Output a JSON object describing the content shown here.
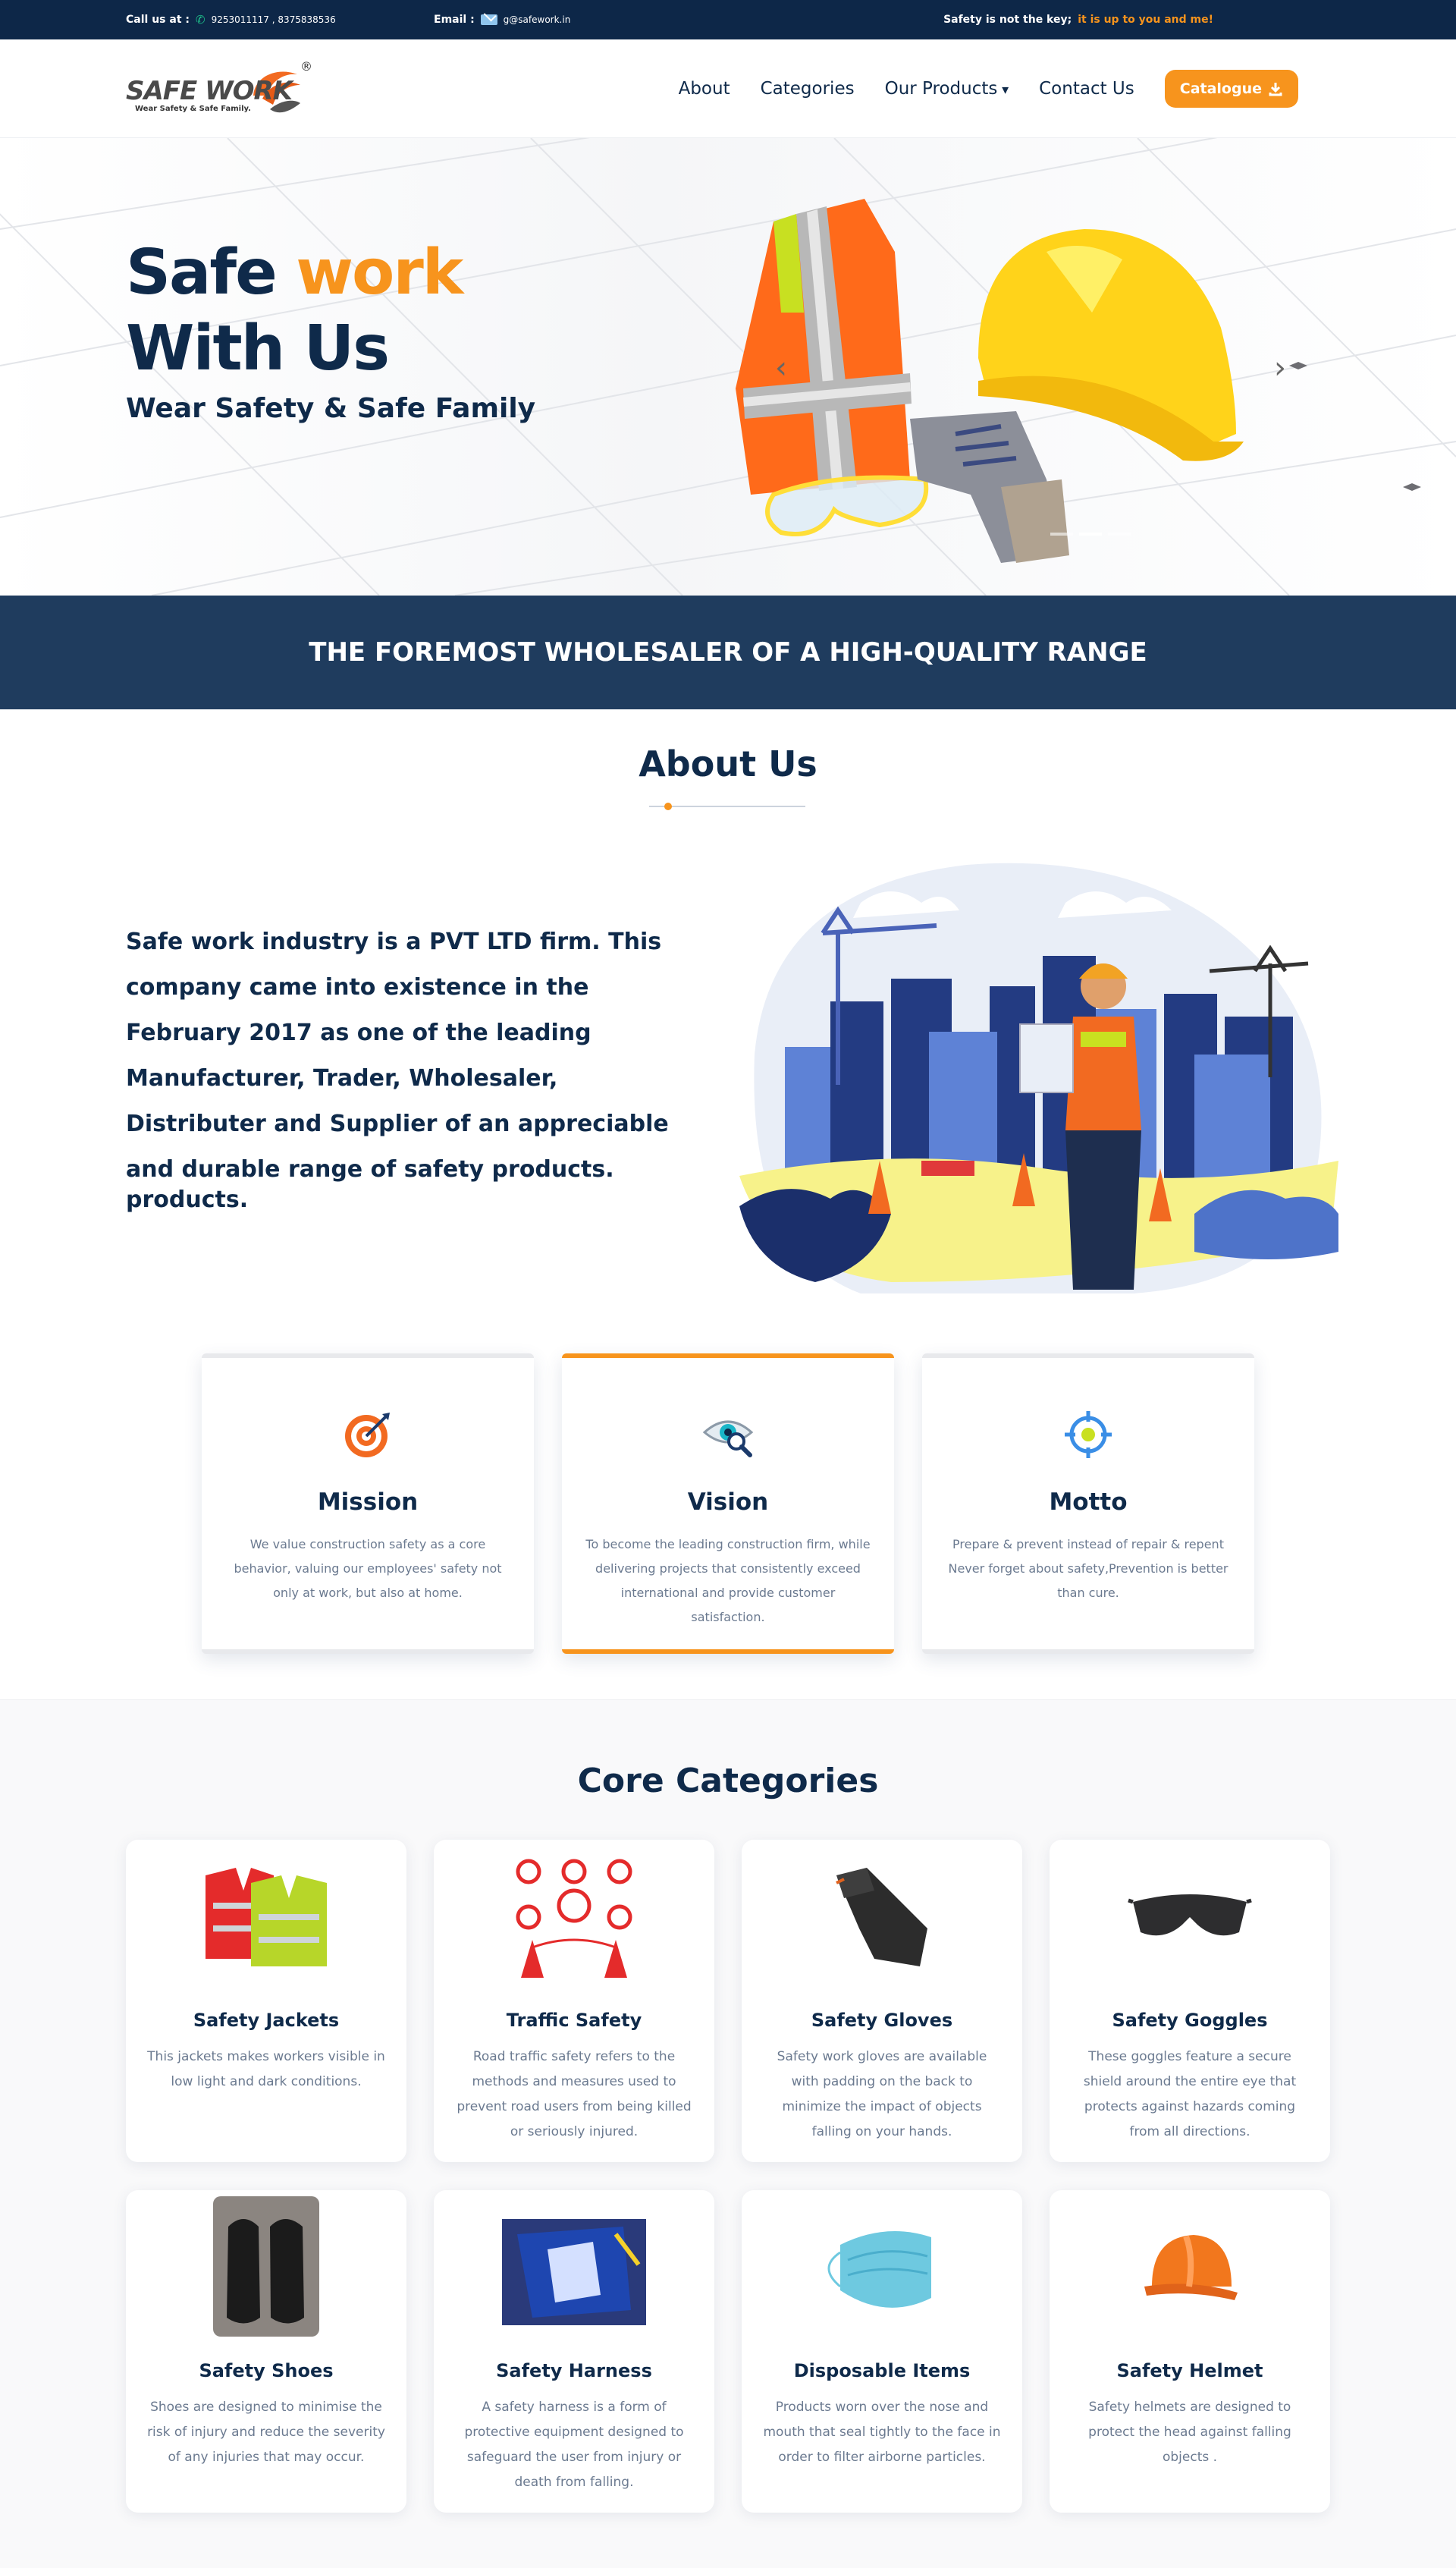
{
  "topbar": {
    "call_label": "Call us at :",
    "phones": "9253011117 , 8375838536",
    "email_label": "Email :",
    "email": "g@safework.in",
    "slogan_a": "Safety is not the key;",
    "slogan_b": "it is up to you and me!"
  },
  "header": {
    "logo_text": "SAFE WORK",
    "logo_tagline": "Wear Safety & Safe Family.",
    "logo_reg": "®",
    "nav": [
      {
        "label": "About"
      },
      {
        "label": "Categories"
      },
      {
        "label": "Our Products"
      },
      {
        "label": "Contact Us"
      }
    ],
    "catalogue_label": "Catalogue"
  },
  "hero": {
    "title_a": "Safe",
    "title_b": "work",
    "title_c": "With Us",
    "subtitle": "Wear Safety & Safe Family",
    "arrow_prev": "‹",
    "arrow_next": "›",
    "slides": 3,
    "active_slide": 2
  },
  "banner": {
    "text": "THE FOREMOST WHOLESALER OF A HIGH-QUALITY RANGE"
  },
  "about": {
    "title": "About Us",
    "text": "Safe work industry is a PVT LTD firm. This company came into existence in the February 2017 as one of the leading Manufacturer, Trader, Wholesaler, Distributer and Supplier of an appreciable and durable range of safety products.",
    "ghost_text": "products."
  },
  "mvm": [
    {
      "icon": "target-icon",
      "title": "Mission",
      "text": "We value construction safety as a core behavior, valuing our employees' safety not only at work, but also at home."
    },
    {
      "icon": "vision-icon",
      "title": "Vision",
      "text": "To become the leading construction firm, while delivering projects that consistently exceed international and provide customer satisfaction."
    },
    {
      "icon": "crosshair-icon",
      "title": "Motto",
      "text": "Prepare & prevent instead of repair & repent Never forget about safety,Prevention is better than cure."
    }
  ],
  "core": {
    "title": "Core Categories",
    "items": [
      {
        "name": "Safety Jackets",
        "desc": "This jackets makes workers visible in low light and dark conditions."
      },
      {
        "name": "Traffic Safety",
        "desc": "Road traffic safety refers to the methods and measures used to prevent road users from being killed or seriously injured."
      },
      {
        "name": "Safety Gloves",
        "desc": "Safety work gloves are available with padding on the back to minimize the impact of objects falling on your hands."
      },
      {
        "name": "Safety Goggles",
        "desc": "These goggles feature a secure shield around the entire eye that protects against hazards coming from all directions."
      },
      {
        "name": "Safety Shoes",
        "desc": "Shoes are designed to minimise the risk of injury and reduce the severity of any injuries that may occur."
      },
      {
        "name": "Safety Harness",
        "desc": "A safety harness is a form of protective equipment designed to safeguard the user from injury or death from falling."
      },
      {
        "name": "Disposable Items",
        "desc": "Products worn over the nose and mouth that seal tightly to the face in order to filter airborne particles."
      },
      {
        "name": "Safety Helmet",
        "desc": "Safety helmets are designed to protect the head against falling objects ."
      }
    ]
  },
  "colors": {
    "navy": "#0d2748",
    "banner": "#1f3c5e",
    "accent": "#f7941d",
    "muted_text": "#6b7a90"
  }
}
